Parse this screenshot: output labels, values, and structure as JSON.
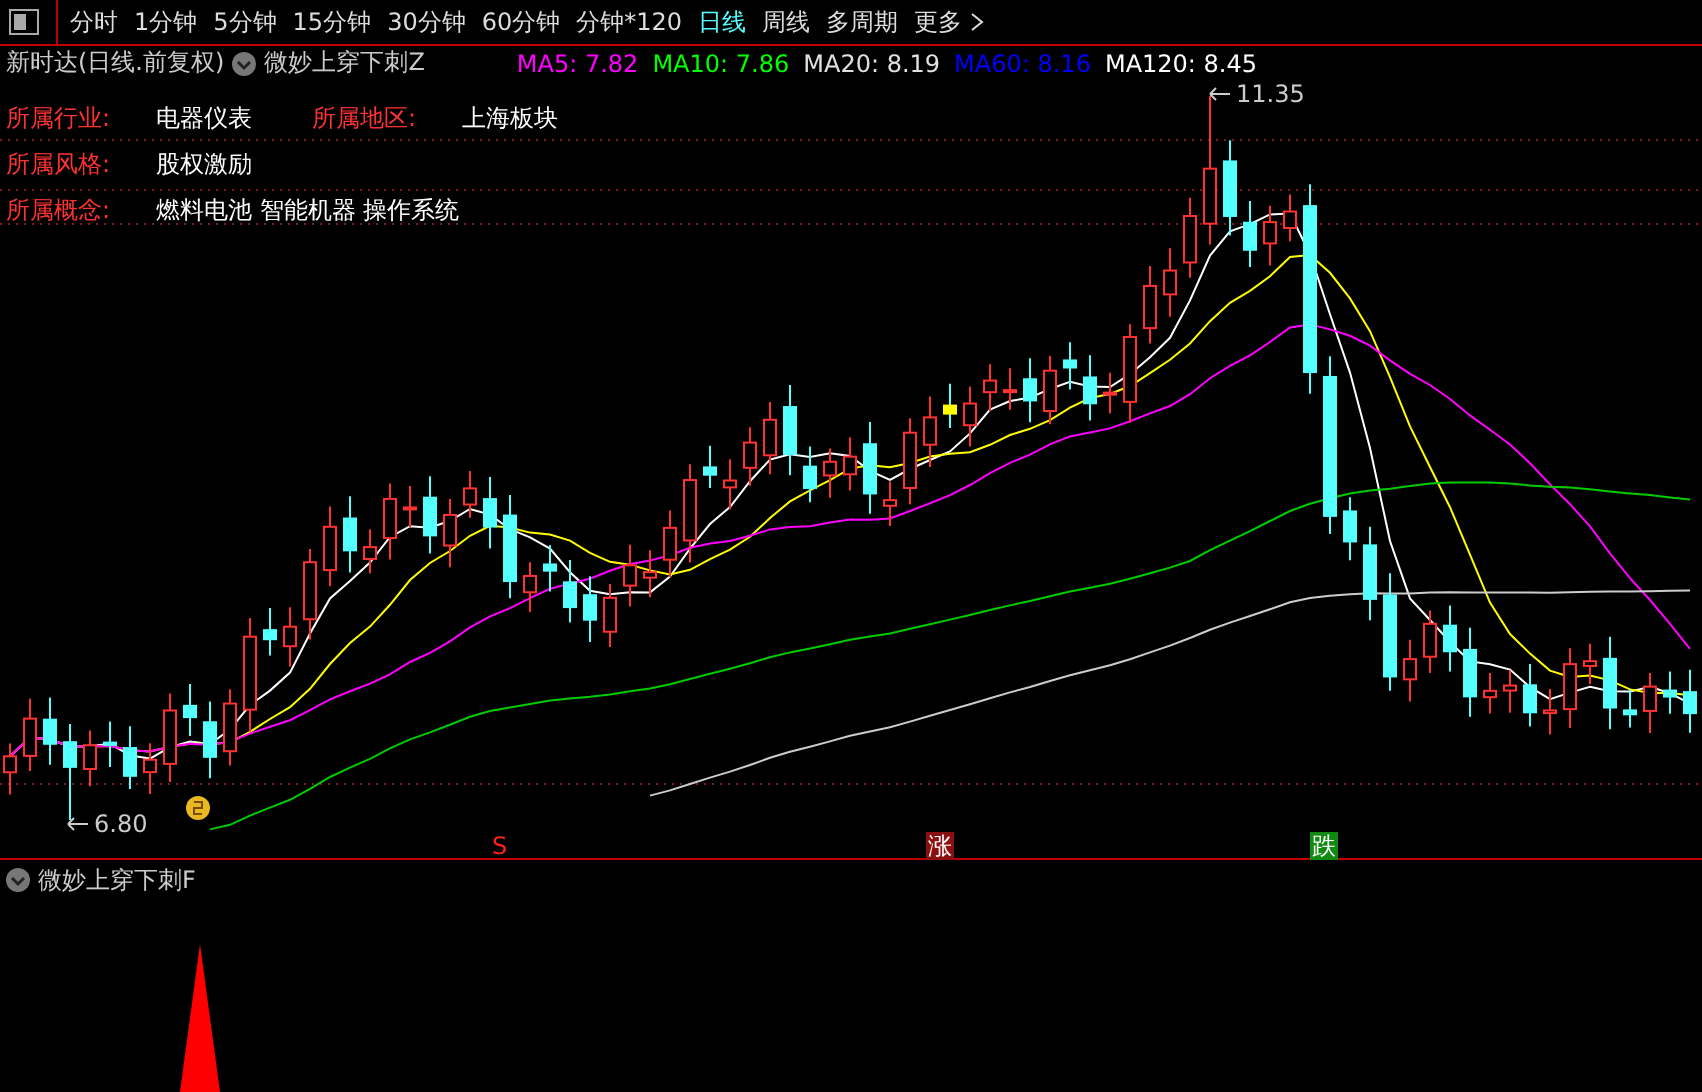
{
  "toolbar": {
    "tabs": [
      {
        "label": "分时",
        "selected": false
      },
      {
        "label": "1分钟",
        "selected": false
      },
      {
        "label": "5分钟",
        "selected": false
      },
      {
        "label": "15分钟",
        "selected": false
      },
      {
        "label": "30分钟",
        "selected": false
      },
      {
        "label": "60分钟",
        "selected": false
      },
      {
        "label": "分钟*120",
        "selected": false
      },
      {
        "label": "日线",
        "selected": true
      },
      {
        "label": "周线",
        "selected": false
      },
      {
        "label": "多周期",
        "selected": false
      }
    ],
    "more": "更多"
  },
  "legend": {
    "title": "新时达(日线.前复权)",
    "indicator": "微妙上穿下刺Z",
    "ma": [
      {
        "label": "MA5: 7.82",
        "color": "#ff00ff"
      },
      {
        "label": "MA10: 7.86",
        "color": "#00ff00"
      },
      {
        "label": "MA20: 8.19",
        "color": "#e0e0e0"
      },
      {
        "label": "MA60: 8.16",
        "color": "#0000ff"
      },
      {
        "label": "MA120: 8.45",
        "color": "#ffffff"
      }
    ]
  },
  "info_rows": [
    [
      {
        "label": "所属行业:",
        "value": "电器仪表"
      },
      {
        "label": "所属地区:",
        "value": "上海板块"
      }
    ],
    [
      {
        "label": "所属风格:",
        "value": "股权激励"
      }
    ],
    [
      {
        "label": "所属概念:",
        "value": "燃料电池 智能机器 操作系统"
      }
    ]
  ],
  "price_marks": {
    "high": "11.35",
    "low": "6.80"
  },
  "signals": [
    {
      "kind": "s",
      "text": "S"
    },
    {
      "kind": "up",
      "text": "涨"
    },
    {
      "kind": "down",
      "text": "跌"
    }
  ],
  "lower_panel": {
    "title": "微妙上穿下刺F"
  }
}
